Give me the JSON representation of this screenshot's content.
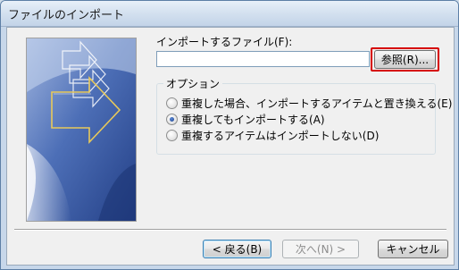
{
  "window": {
    "title": "ファイルのインポート"
  },
  "form": {
    "file_label": "インポートするファイル(F):",
    "file_value": "",
    "browse_label": "参照(R)..."
  },
  "options": {
    "legend": "オプション",
    "items": [
      {
        "label": "重複した場合、インポートするアイテムと置き換える(E)",
        "checked": false
      },
      {
        "label": "重複してもインポートする(A)",
        "checked": true
      },
      {
        "label": "重複するアイテムはインポートしない(D)",
        "checked": false
      }
    ]
  },
  "buttons": {
    "back": "< 戻る(B)",
    "next": "次へ(N) >",
    "cancel": "キャンセル"
  },
  "colors": {
    "highlight": "#d60000",
    "banner": "#3c5fa6"
  }
}
